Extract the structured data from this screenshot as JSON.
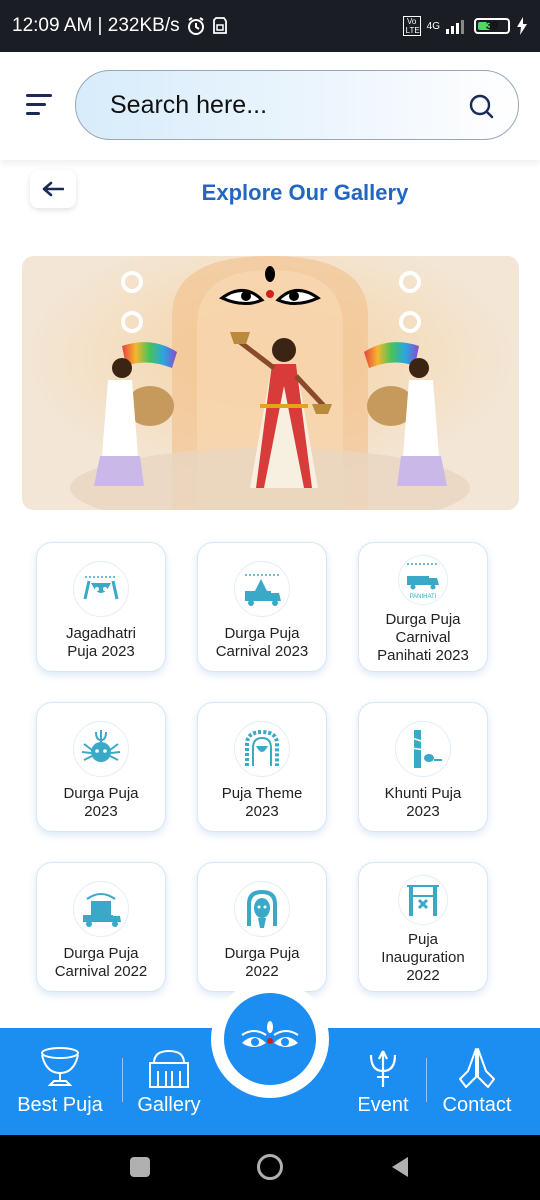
{
  "status_bar": {
    "time_speed": "12:09 AM | 232KB/s",
    "network": "4G",
    "volte": "Vo LTE",
    "battery": "39"
  },
  "header": {
    "search_placeholder": "Search here..."
  },
  "page": {
    "title": "Explore Our Gallery"
  },
  "gallery": {
    "items": [
      {
        "line1": "Jagadhatri",
        "line2": "Puja 2023",
        "line3": "",
        "icon": "goddess-face-icon"
      },
      {
        "line1": "Durga Puja",
        "line2": "Carnival 2023",
        "line3": "",
        "icon": "carnival-truck-icon"
      },
      {
        "line1": "Durga Puja",
        "line2": "Carnival",
        "line3": "Panihati 2023",
        "icon": "panihati-truck-icon",
        "badge": "PANIHATI"
      },
      {
        "line1": "Durga Puja",
        "line2": "2023",
        "line3": "",
        "icon": "durga-trident-icon"
      },
      {
        "line1": "Puja Theme",
        "line2": "2023",
        "line3": "",
        "icon": "pandal-theme-icon"
      },
      {
        "line1": "Khunti Puja",
        "line2": "2023",
        "line3": "",
        "icon": "khunti-pole-icon"
      },
      {
        "line1": "Durga Puja",
        "line2": "Carnival 2022",
        "line3": "",
        "icon": "carnival-float-icon"
      },
      {
        "line1": "Durga Puja",
        "line2": "2022",
        "line3": "",
        "icon": "durga-idol-icon"
      },
      {
        "line1": "Puja",
        "line2": "Inauguration",
        "line3": "2022",
        "icon": "ribbon-cutting-icon"
      }
    ]
  },
  "bottom_nav": {
    "items": [
      {
        "label": "Best Puja",
        "icon": "trophy-icon"
      },
      {
        "label": "Gallery",
        "icon": "temple-icon"
      },
      {
        "label": "Event",
        "icon": "trident-icon"
      },
      {
        "label": "Contact",
        "icon": "namaste-icon"
      }
    ]
  },
  "colors": {
    "accent": "#1c8ef2",
    "title": "#2266c2",
    "icon": "#3aa9c8"
  }
}
